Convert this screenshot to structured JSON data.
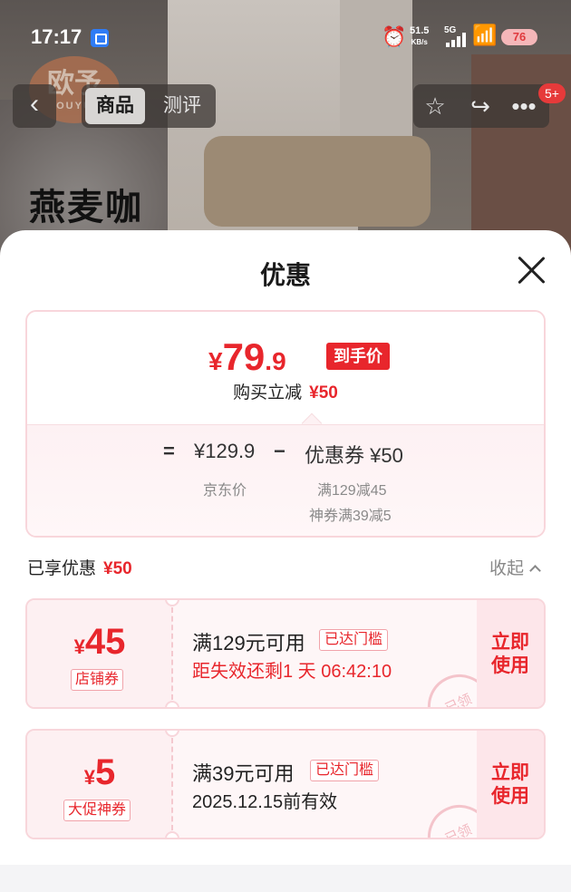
{
  "status_bar": {
    "time": "17:17",
    "net_speed_value": "51.5",
    "net_speed_unit": "KB/s",
    "network": "5G",
    "battery": "76",
    "icons": [
      "app-notification-icon",
      "alarm-icon",
      "signal-icon",
      "wifi-icon",
      "battery-icon"
    ]
  },
  "background": {
    "brand_logo": "欧予",
    "brand_logo_sub": "OUYU",
    "product_title": "燕麦咖"
  },
  "nav": {
    "tabs": [
      {
        "label": "商品",
        "active": true
      },
      {
        "label": "测评",
        "active": false
      }
    ],
    "badge": "5+",
    "icons": [
      "back-icon",
      "star-icon",
      "share-icon",
      "more-icon"
    ]
  },
  "sheet": {
    "title": "优惠",
    "summary": {
      "yen": "¥",
      "price_int": "79",
      "price_dec": ".9",
      "price_tag": "到手价",
      "instant_label": "购买立减",
      "instant_amount": "¥50",
      "eq": "=",
      "jd_price": "¥129.9",
      "minus": "−",
      "coupon_total": "优惠券 ¥50",
      "jd_price_label": "京东价",
      "coupon_detail_1": "满129减45",
      "coupon_detail_2": "神券满39减5"
    },
    "enjoyed": {
      "label": "已享优惠",
      "amount": "¥50",
      "collapse": "收起"
    },
    "coupons": [
      {
        "yen": "¥",
        "amount": "45",
        "type": "店铺券",
        "condition": "满129元可用",
        "status": "已达门槛",
        "expire": "距失效还剩1 天 06:42:10",
        "button": "立即\n使用",
        "button_line1": "立即",
        "button_line2": "使用",
        "stamp": "已领",
        "accent": "#e8262c"
      },
      {
        "yen": "¥",
        "amount": "5",
        "type": "大促神券",
        "condition": "满39元可用",
        "status": "已达门槛",
        "expire": "2025.12.15前有效",
        "button_line1": "立即",
        "button_line2": "使用",
        "stamp": "已领"
      }
    ]
  },
  "colors": {
    "accent_red": "#e8262c",
    "border_pink": "#f8d6db",
    "sheet_bg": "#ffffff"
  }
}
